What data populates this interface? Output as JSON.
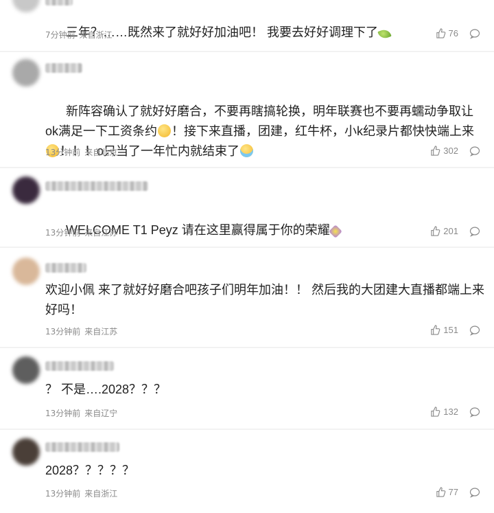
{
  "comments": [
    {
      "text_before": "三年？……既然来了就好好加油吧！ 我要去好好调理下了",
      "emoji_end": "leaf-emoji",
      "time": "7分钟前",
      "location": "来自浙江",
      "likes": "76",
      "avatar_color": "#c8c8c8"
    },
    {
      "text_part1": "新阵容确认了就好好磨合，不要再瞎搞轮换，明年联赛也不要再蠕动争取让ok满足一下工资条约",
      "text_part2": "！接下来直播，团建，红牛杯，小k纪录片都快快端上来",
      "text_part3": "！！！o只当了一年忙内就结束了",
      "time": "13分钟前",
      "location": "来自北京",
      "likes": "302",
      "avatar_color": "#a9a9a9"
    },
    {
      "text_before": "WELCOME T1 Peyz 请在这里赢得属于你的荣耀",
      "emoji_end": "sparkle-emoji",
      "time": "13分钟前",
      "location": "来自江苏",
      "likes": "201",
      "avatar_color": "#3a2a3e"
    },
    {
      "text": "欢迎小佩 来了就好好磨合吧孩子们明年加油！！ 然后我的大团建大直播都端上来好吗！",
      "time": "13分钟前",
      "location": "来自江苏",
      "likes": "151",
      "avatar_color": "#d9b89a"
    },
    {
      "text": "？ 不是….2028？？？",
      "time": "13分钟前",
      "location": "来自辽宁",
      "likes": "132",
      "avatar_color": "#5e5e5e"
    },
    {
      "text": "2028？？？？？",
      "time": "13分钟前",
      "location": "来自浙江",
      "likes": "77",
      "avatar_color": "#4a3f38"
    }
  ],
  "colors": {
    "page_bg": "#f2f2f2",
    "card_bg": "#ffffff",
    "meta_text": "#8a8a8a"
  }
}
